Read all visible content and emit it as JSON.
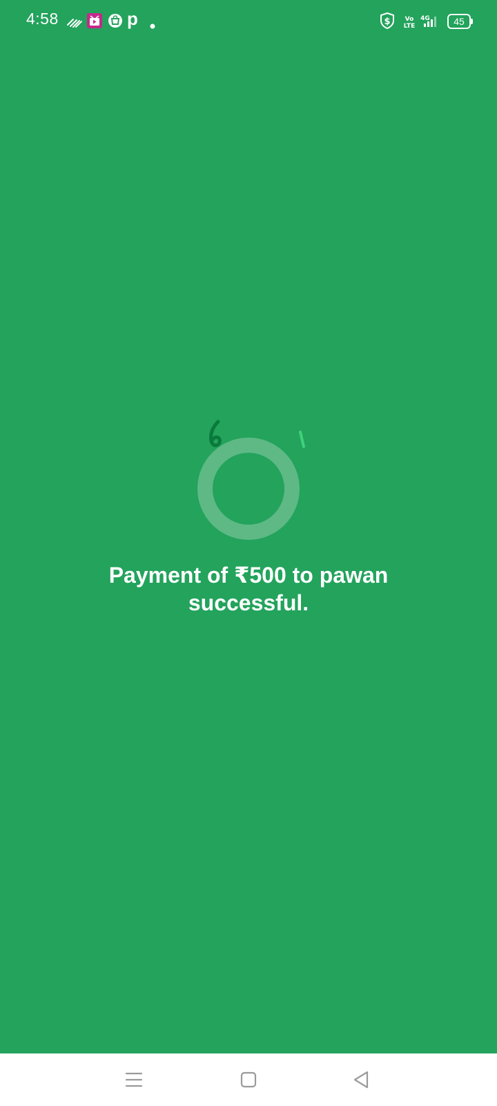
{
  "status_bar": {
    "time": "4:58",
    "battery": "45",
    "network": "4G",
    "icons": [
      "signal-waves-icon",
      "video-app-icon",
      "bag-icon",
      "paytm-p-icon",
      "dot-icon",
      "shield-dollar-icon",
      "volte-icon",
      "cellular-signal-icon",
      "battery-icon"
    ],
    "paytm_letter": "p"
  },
  "main": {
    "message_line1": "Payment of ₹500 to pawan",
    "message_line2": "successful.",
    "background_color": "#23a35c"
  },
  "nav_bar": {
    "items": [
      "menu-icon",
      "home-icon",
      "back-icon"
    ]
  }
}
